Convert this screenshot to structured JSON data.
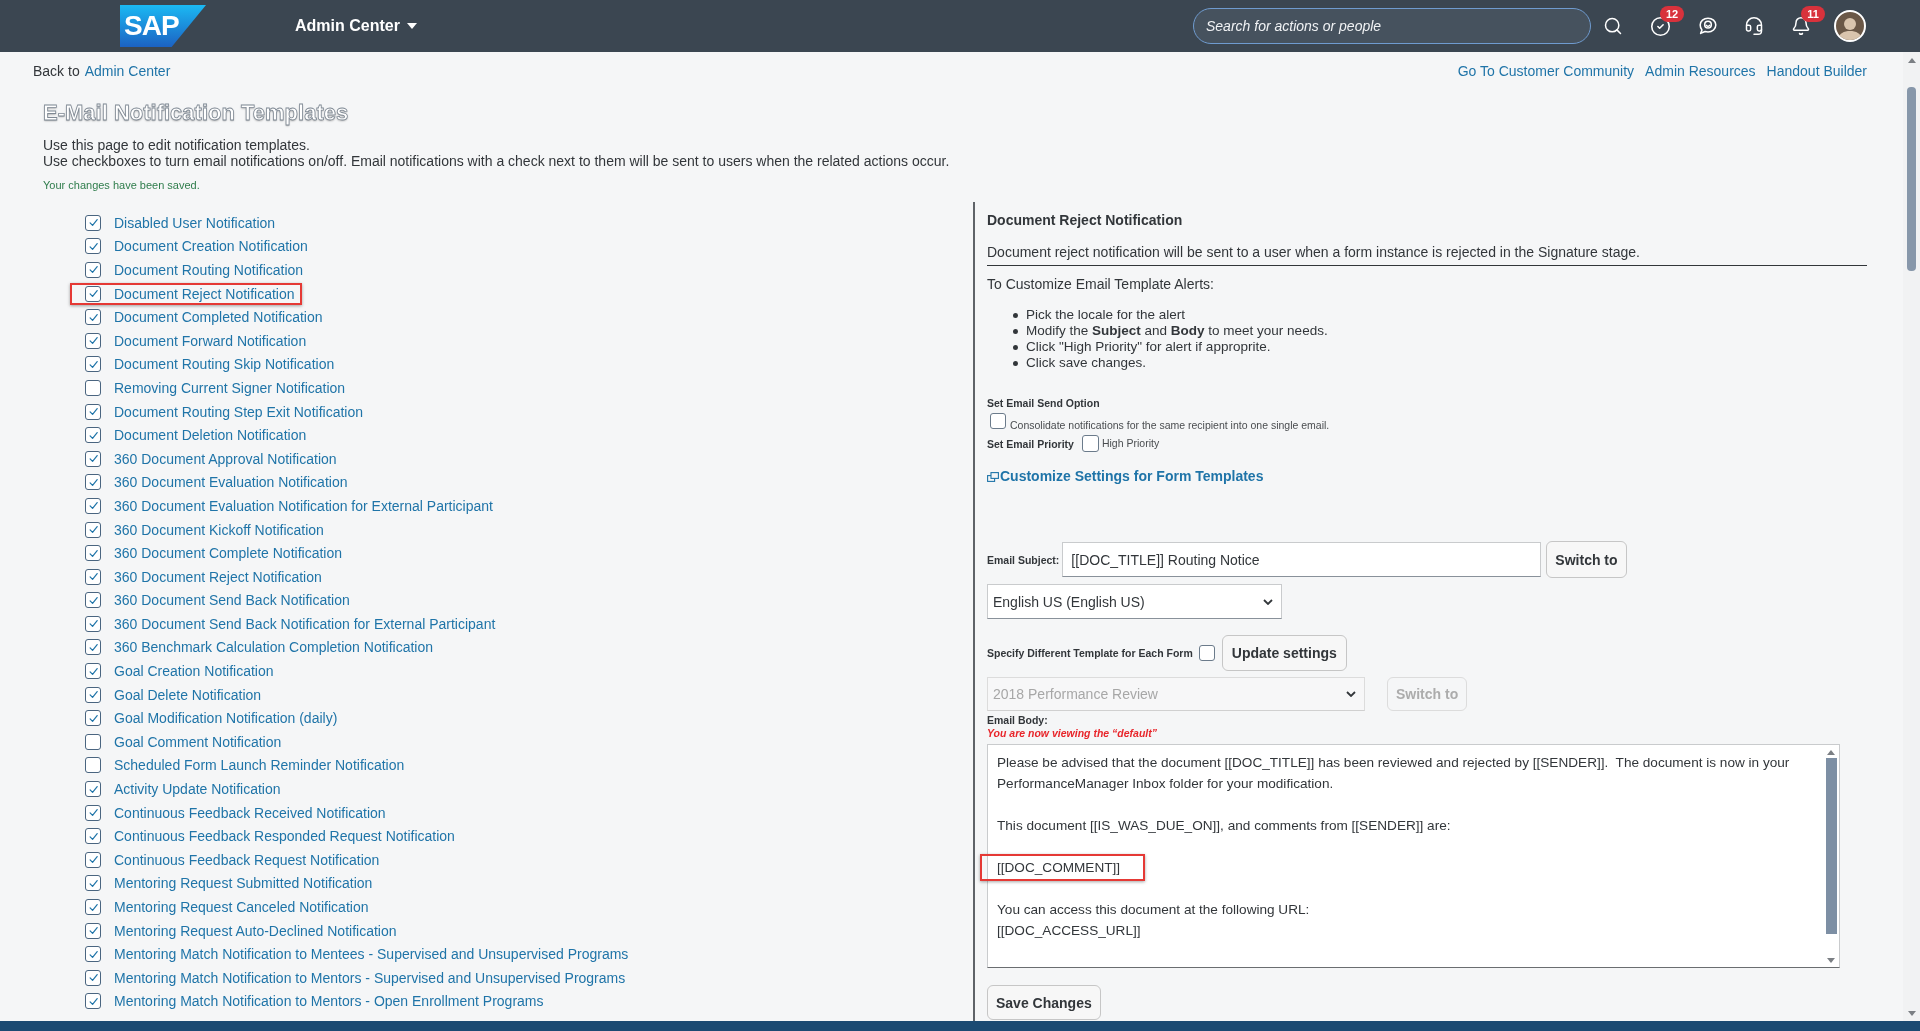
{
  "header": {
    "logo": "SAP",
    "app_menu": "Admin Center",
    "search": {
      "placeholder": "Search for actions or people"
    },
    "tasks_badge": "12",
    "notifications_badge": "11"
  },
  "nav": {
    "back_prefix": "Back to",
    "back_link": "Admin Center",
    "links": [
      "Go To Customer Community",
      "Admin Resources",
      "Handout Builder"
    ]
  },
  "intro": {
    "title": "E-Mail Notification Templates",
    "lines": [
      "Use this page to edit notification templates.",
      "Use checkboxes to turn email notifications on/off. Email notifications with a check next to them will be sent to users when the related actions occur."
    ],
    "status": "Your changes have been saved."
  },
  "notifications": [
    {
      "label": "Disabled User Notification",
      "checked": true,
      "highlighted": false
    },
    {
      "label": "Document Creation Notification",
      "checked": true,
      "highlighted": false
    },
    {
      "label": "Document Routing Notification",
      "checked": true,
      "highlighted": false
    },
    {
      "label": "Document Reject Notification",
      "checked": true,
      "highlighted": true
    },
    {
      "label": "Document Completed Notification",
      "checked": true,
      "highlighted": false
    },
    {
      "label": "Document Forward Notification",
      "checked": true,
      "highlighted": false
    },
    {
      "label": "Document Routing Skip Notification",
      "checked": true,
      "highlighted": false
    },
    {
      "label": "Removing Current Signer Notification",
      "checked": false,
      "highlighted": false
    },
    {
      "label": "Document Routing Step Exit Notification",
      "checked": true,
      "highlighted": false
    },
    {
      "label": "Document Deletion Notification",
      "checked": true,
      "highlighted": false
    },
    {
      "label": "360 Document Approval Notification",
      "checked": true,
      "highlighted": false
    },
    {
      "label": "360 Document Evaluation Notification",
      "checked": true,
      "highlighted": false
    },
    {
      "label": "360 Document Evaluation Notification for External Participant",
      "checked": true,
      "highlighted": false
    },
    {
      "label": "360 Document Kickoff Notification",
      "checked": true,
      "highlighted": false
    },
    {
      "label": "360 Document Complete Notification",
      "checked": true,
      "highlighted": false
    },
    {
      "label": "360 Document Reject Notification",
      "checked": true,
      "highlighted": false
    },
    {
      "label": "360 Document Send Back Notification",
      "checked": true,
      "highlighted": false
    },
    {
      "label": "360 Document Send Back Notification for External Participant",
      "checked": true,
      "highlighted": false
    },
    {
      "label": "360 Benchmark Calculation Completion Notification",
      "checked": true,
      "highlighted": false
    },
    {
      "label": "Goal Creation Notification",
      "checked": true,
      "highlighted": false
    },
    {
      "label": "Goal Delete Notification",
      "checked": true,
      "highlighted": false
    },
    {
      "label": "Goal Modification Notification (daily)",
      "checked": true,
      "highlighted": false
    },
    {
      "label": "Goal Comment Notification",
      "checked": false,
      "highlighted": false
    },
    {
      "label": "Scheduled Form Launch Reminder Notification",
      "checked": false,
      "highlighted": false
    },
    {
      "label": "Activity Update Notification",
      "checked": true,
      "highlighted": false
    },
    {
      "label": "Continuous Feedback Received Notification",
      "checked": true,
      "highlighted": false
    },
    {
      "label": "Continuous Feedback Responded Request Notification",
      "checked": true,
      "highlighted": false
    },
    {
      "label": "Continuous Feedback Request Notification",
      "checked": true,
      "highlighted": false
    },
    {
      "label": "Mentoring Request Submitted Notification",
      "checked": true,
      "highlighted": false
    },
    {
      "label": "Mentoring Request Canceled Notification",
      "checked": true,
      "highlighted": false
    },
    {
      "label": "Mentoring Request Auto-Declined Notification",
      "checked": true,
      "highlighted": false
    },
    {
      "label": "Mentoring Match Notification to Mentees - Supervised and Unsupervised Programs",
      "checked": true,
      "highlighted": false
    },
    {
      "label": "Mentoring Match Notification to Mentors - Supervised and Unsupervised Programs",
      "checked": true,
      "highlighted": false
    },
    {
      "label": "Mentoring Match Notification to Mentors - Open Enrollment Programs",
      "checked": true,
      "highlighted": false
    }
  ],
  "detail": {
    "title": "Document Reject Notification",
    "description": "Document reject notification will be sent to a user when a form instance is rejected in the Signature stage.",
    "instructions_heading": "To Customize Email Template Alerts:",
    "instructions": [
      "Pick the locale for the alert",
      "Modify the **Subject** and **Body** to meet your needs.",
      "Click \"High Priority\" for alert if approprite.",
      "Click save changes."
    ],
    "send_option": {
      "label": "Set Email Send Option",
      "checkbox_label": "Consolidate notifications for the same recipient into one single email.",
      "checked": false
    },
    "priority": {
      "label": "Set Email Priority",
      "checkbox_label": "High Priority",
      "checked": false
    },
    "customize_link": "Customize Settings for Form Templates",
    "subject": {
      "label": "Email Subject:",
      "value": "[[DOC_TITLE]] Routing Notice",
      "button": "Switch to"
    },
    "locale_select": "English US (English US)",
    "per_form": {
      "label": "Specify Different Template for Each Form",
      "checked": false,
      "button": "Update settings"
    },
    "form_select": {
      "value": "2018 Performance Review",
      "disabled": true
    },
    "form_switch_button": {
      "label": "Switch to",
      "disabled": true
    },
    "body": {
      "label": "Email Body:",
      "viewing_note": "You are now viewing the “default”",
      "paragraphs": [
        {
          "lines": [
            "Please be advised that the document [[DOC_TITLE]] has been reviewed and rejected by [[SENDER]].  The document is now in your PerformanceManager Inbox folder for your modification."
          ],
          "highlighted": false
        },
        {
          "lines": [
            "This document [[IS_WAS_DUE_ON]], and comments from [[SENDER]] are:"
          ],
          "highlighted": false
        },
        {
          "lines": [
            "[[DOC_COMMENT]]"
          ],
          "highlighted": true
        },
        {
          "lines": [
            "You can access this document at the following URL:",
            "[[DOC_ACCESS_URL]]"
          ],
          "highlighted": false
        }
      ]
    },
    "save_button": "Save Changes"
  }
}
